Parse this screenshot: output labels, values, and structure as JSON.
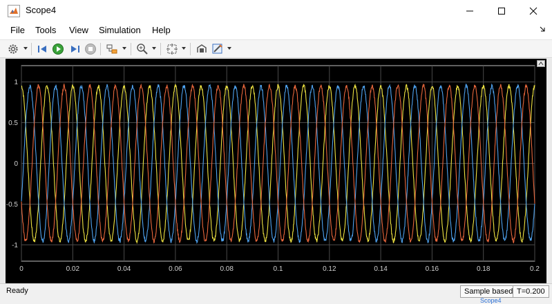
{
  "window": {
    "title": "Scope4"
  },
  "menu": {
    "file": "File",
    "tools": "Tools",
    "view": "View",
    "simulation": "Simulation",
    "help": "Help"
  },
  "toolbar": {
    "icons": [
      "gear-icon",
      "step-back-icon",
      "run-icon",
      "step-forward-icon",
      "stop-icon",
      "highlight-block-icon",
      "zoom-icon",
      "fit-to-view-icon",
      "cursor-measurements-icon",
      "style-icon"
    ]
  },
  "status": {
    "ready": "Ready",
    "sample_mode": "Sample based",
    "time": "T=0.200"
  },
  "footer_label": "Scope4",
  "chart_data": {
    "type": "line",
    "xlim": [
      0,
      0.2
    ],
    "ylim": [
      -1.2,
      1.2
    ],
    "x_ticks": [
      0,
      0.02,
      0.04,
      0.06,
      0.08,
      0.1,
      0.12,
      0.14,
      0.16,
      0.18,
      0.2
    ],
    "x_tick_labels": [
      "0",
      "0.02",
      "0.04",
      "0.06",
      "0.08",
      "0.1",
      "0.12",
      "0.14",
      "0.16",
      "0.18",
      "0.2"
    ],
    "y_ticks": [
      -1,
      -0.5,
      0,
      0.5,
      1
    ],
    "y_tick_labels": [
      "-1",
      "-0.5",
      "0",
      "0.5",
      "1"
    ],
    "grid": true,
    "background": "#000000",
    "axes_color": "#c0c0c0",
    "series": [
      {
        "color": "#f0e442",
        "amplitude": 0.95,
        "frequency_hz": 100,
        "phase_deg": 90
      },
      {
        "color": "#4fa3f0",
        "amplitude": 0.95,
        "frequency_hz": 100,
        "phase_deg": -30
      },
      {
        "color": "#e8673c",
        "amplitude": 0.95,
        "frequency_hz": 100,
        "phase_deg": 210
      }
    ]
  }
}
